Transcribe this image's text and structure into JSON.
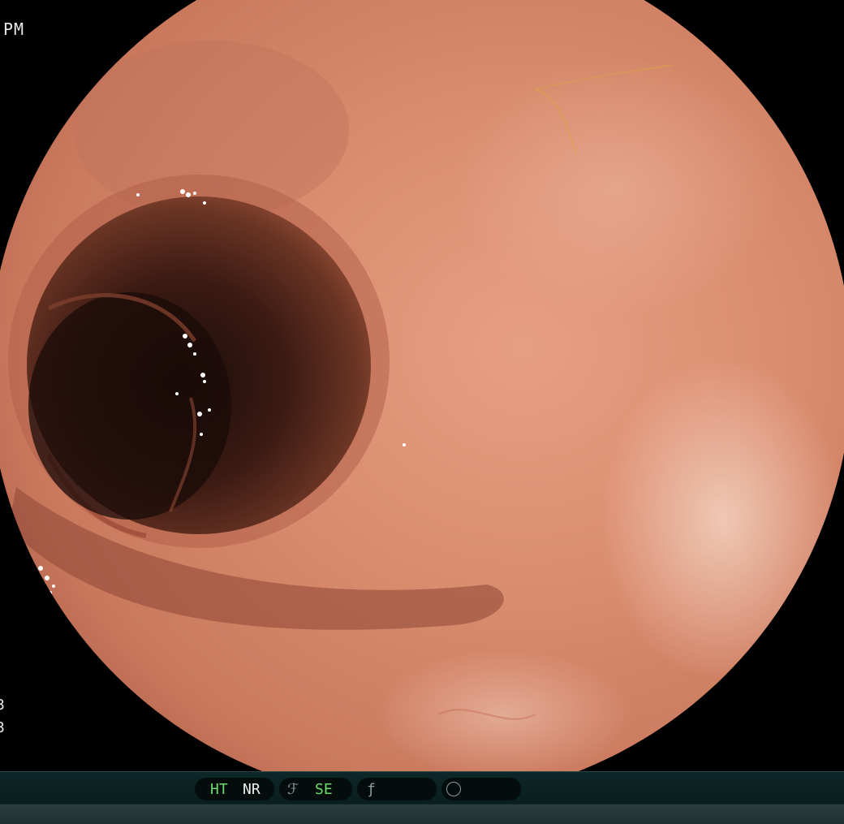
{
  "overlay": {
    "time_suffix": "PM",
    "side_tick_1": "3",
    "side_tick_2": "3"
  },
  "status_bar": {
    "ht": "HT",
    "nr": "NR",
    "se": "SE"
  },
  "icons": {
    "structure": "structure-enhancement-icon",
    "contrast": "contrast-icon",
    "color": "color-mode-icon"
  },
  "colors": {
    "mucosa": "#d98a6e",
    "lumen": "#2a1410",
    "status_green": "#6bdc6b",
    "status_bar": "#0d2627"
  }
}
